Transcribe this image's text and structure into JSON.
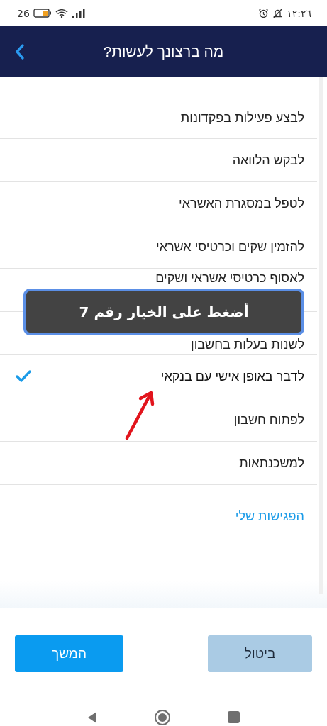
{
  "status_bar": {
    "temperature": "26",
    "time": "١٢:٢٦"
  },
  "header": {
    "title": "מה ברצונך לעשות?"
  },
  "options": [
    {
      "label": "לבצע פעילות בפקדונות",
      "selected": false
    },
    {
      "label": "לבקש הלוואה",
      "selected": false
    },
    {
      "label": "לטפל במסגרת האשראי",
      "selected": false
    },
    {
      "label": "להזמין שקים וכרטיסי אשראי",
      "selected": false
    },
    {
      "label": "לאסוף כרטיסי אשראי ושקים",
      "selected": false
    },
    {
      "label": "לשנות בעלות בחשבון",
      "selected": false
    },
    {
      "label": "לדבר באופן אישי עם בנקאי",
      "selected": true
    },
    {
      "label": "לפתוח חשבון",
      "selected": false
    },
    {
      "label": "למשכנתאות",
      "selected": false
    }
  ],
  "meetings_link": "הפגישות שלי",
  "callout": {
    "text": "أضغط على الخيار رقم 7"
  },
  "buttons": [
    {
      "label": "ביטול",
      "kind": "secondary"
    },
    {
      "label": "המשך",
      "kind": "primary"
    }
  ]
}
